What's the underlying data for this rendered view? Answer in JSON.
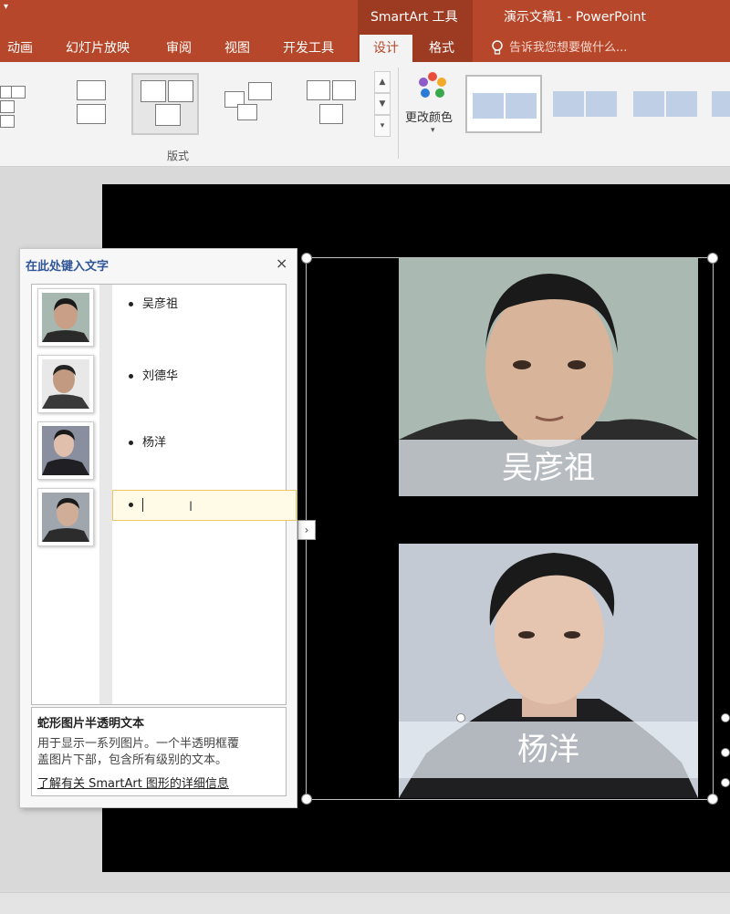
{
  "titlebar": {
    "context_tab": "SmartArt 工具",
    "doc_title": "演示文稿1 - PowerPoint"
  },
  "tabs": [
    {
      "label": "动画"
    },
    {
      "label": "幻灯片放映"
    },
    {
      "label": "审阅"
    },
    {
      "label": "视图"
    },
    {
      "label": "开发工具"
    }
  ],
  "ctx_tabs": [
    {
      "label": "设计"
    },
    {
      "label": "格式"
    }
  ],
  "tell_me": "告诉我您想要做什么...",
  "ribbon": {
    "layouts_group_label": "版式",
    "change_colors_label": "更改颜色",
    "colors": [
      "#e94e3c",
      "#f4a92a",
      "#38a84a",
      "#2b7bd6",
      "#8e5bc9"
    ]
  },
  "text_pane": {
    "title": "在此处键入文字",
    "items": [
      "吴彦祖",
      "刘德华",
      "杨洋",
      ""
    ],
    "desc_title": "蛇形图片半透明文本",
    "desc_line1": "用于显示一系列图片。一个半透明框覆",
    "desc_line2": "盖图片下部，包含所有级别的文本。",
    "desc_link": "了解有关 SmartArt 图形的详细信息"
  },
  "slide": {
    "captions": [
      "吴彦祖",
      "杨洋"
    ]
  }
}
